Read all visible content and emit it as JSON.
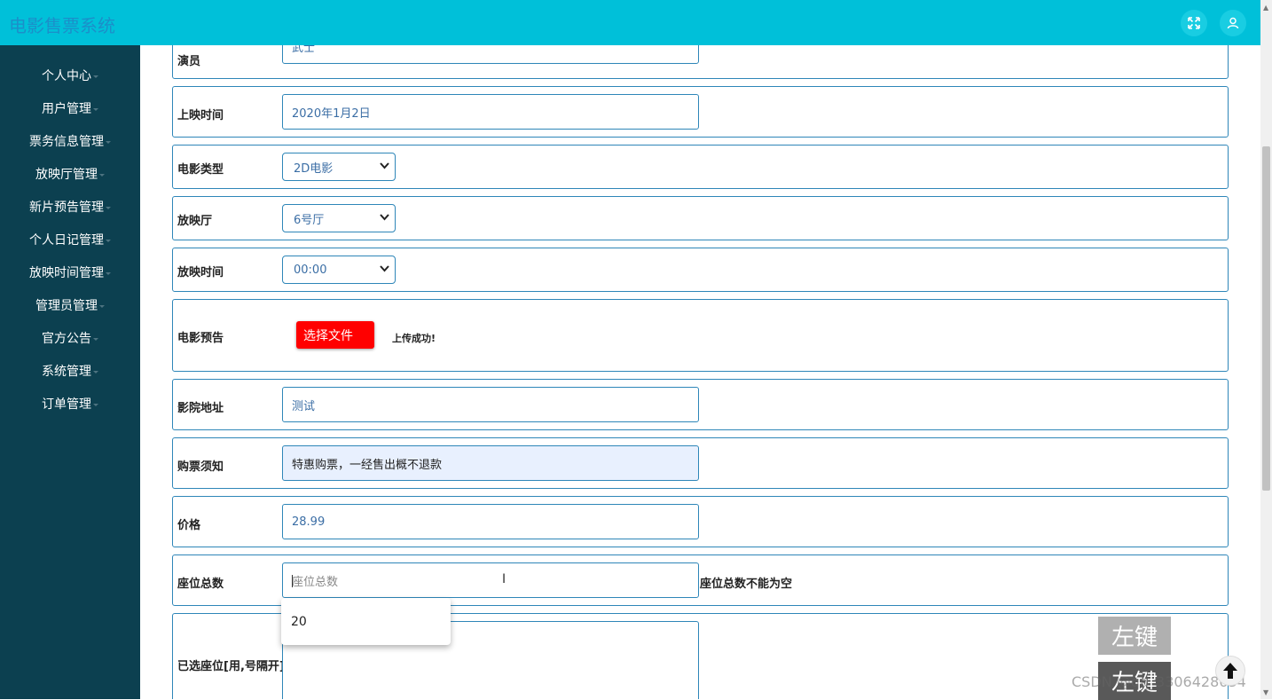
{
  "app": {
    "title": "电影售票系统"
  },
  "colors": {
    "header": "#00c0d9",
    "sidebar": "#0c4050",
    "upload_button": "#ff0000",
    "field_border": "#2e86b8"
  },
  "header_icons": [
    "fullscreen-icon",
    "user-icon"
  ],
  "sidebar": {
    "items": [
      {
        "label": "个人中心"
      },
      {
        "label": "用户管理"
      },
      {
        "label": "票务信息管理"
      },
      {
        "label": "放映厅管理"
      },
      {
        "label": "新片预告管理"
      },
      {
        "label": "个人日记管理"
      },
      {
        "label": "放映时间管理"
      },
      {
        "label": "管理员管理"
      },
      {
        "label": "官方公告"
      },
      {
        "label": "系统管理"
      },
      {
        "label": "订单管理"
      }
    ]
  },
  "form": {
    "actor": {
      "label": "演员",
      "value": "武士"
    },
    "release_date": {
      "label": "上映时间",
      "value": "2020年1月2日"
    },
    "movie_type": {
      "label": "电影类型",
      "value": "2D电影"
    },
    "hall": {
      "label": "放映厅",
      "value": "6号厅"
    },
    "show_time": {
      "label": "放映时间",
      "value": "00:00"
    },
    "trailer": {
      "label": "电影预告",
      "button": "选择文件",
      "status": "上传成功!"
    },
    "cinema_address": {
      "label": "影院地址",
      "value": "测试"
    },
    "purchase_notice": {
      "label": "购票须知",
      "value": "特惠购票，一经售出概不退款"
    },
    "price": {
      "label": "价格",
      "value": "28.99"
    },
    "seat_total": {
      "label": "座位总数",
      "placeholder": "座位总数",
      "error": "座位总数不能为空"
    },
    "selected_seats": {
      "label": "已选座位[用,号隔开]",
      "value": ""
    }
  },
  "autocomplete": {
    "option": "20"
  },
  "overlays": {
    "key_badge_1": "左键",
    "key_badge_2": "左键",
    "watermark": "CSDN @qq_3306428634"
  }
}
